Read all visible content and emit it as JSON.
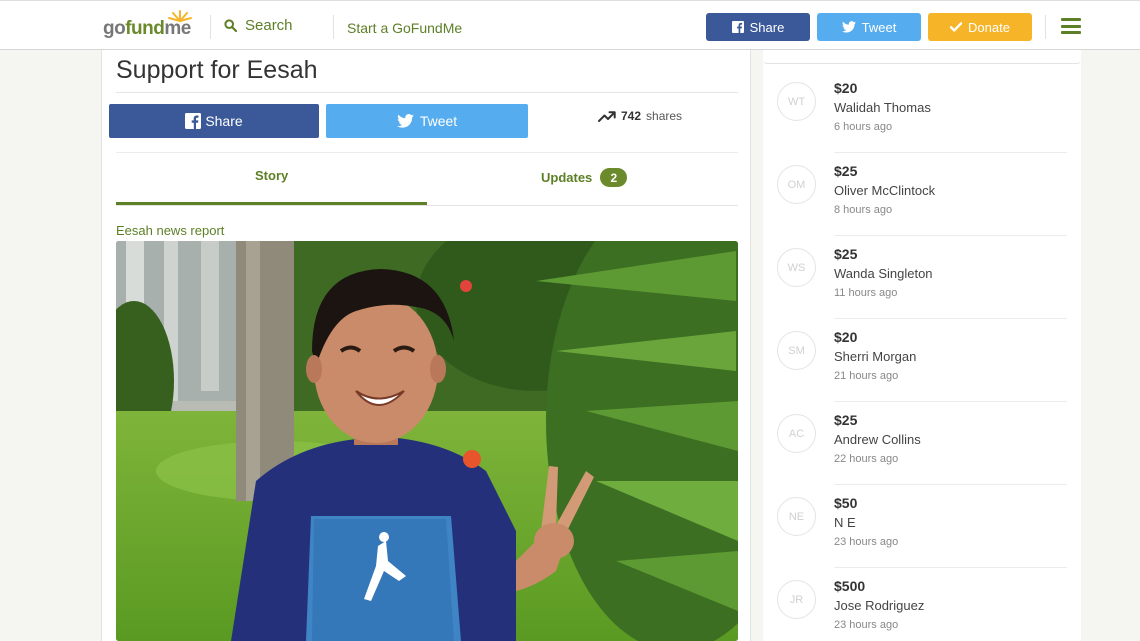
{
  "header": {
    "logo_parts": [
      "go",
      "fund",
      "me"
    ],
    "search_label": "Search",
    "start_label": "Start a GoFundMe",
    "share_label": "Share",
    "tweet_label": "Tweet",
    "donate_label": "Donate"
  },
  "campaign": {
    "title": "Support for Eesah",
    "share_label": "Share",
    "tweet_label": "Tweet",
    "shares_count": "742",
    "shares_label": "shares",
    "tabs": [
      {
        "label": "Story"
      },
      {
        "label": "Updates",
        "badge": "2"
      }
    ],
    "media_caption": "Eesah news report"
  },
  "donations": [
    {
      "initials": "WT",
      "amount": "$20",
      "name": "Walidah Thomas",
      "time": "6 hours ago"
    },
    {
      "initials": "OM",
      "amount": "$25",
      "name": "Oliver McClintock",
      "time": "8 hours ago"
    },
    {
      "initials": "WS",
      "amount": "$25",
      "name": "Wanda Singleton",
      "time": "11 hours ago"
    },
    {
      "initials": "SM",
      "amount": "$20",
      "name": "Sherri Morgan",
      "time": "21 hours ago"
    },
    {
      "initials": "AC",
      "amount": "$25",
      "name": "Andrew Collins",
      "time": "22 hours ago"
    },
    {
      "initials": "NE",
      "amount": "$50",
      "name": "N E",
      "time": "23 hours ago"
    },
    {
      "initials": "JR",
      "amount": "$500",
      "name": "Jose Rodriguez",
      "time": "23 hours ago"
    }
  ],
  "colors": {
    "brand_green": "#5d7f26",
    "facebook_blue": "#3b5998",
    "twitter_blue": "#55acee",
    "donate_orange": "#f6b429"
  }
}
